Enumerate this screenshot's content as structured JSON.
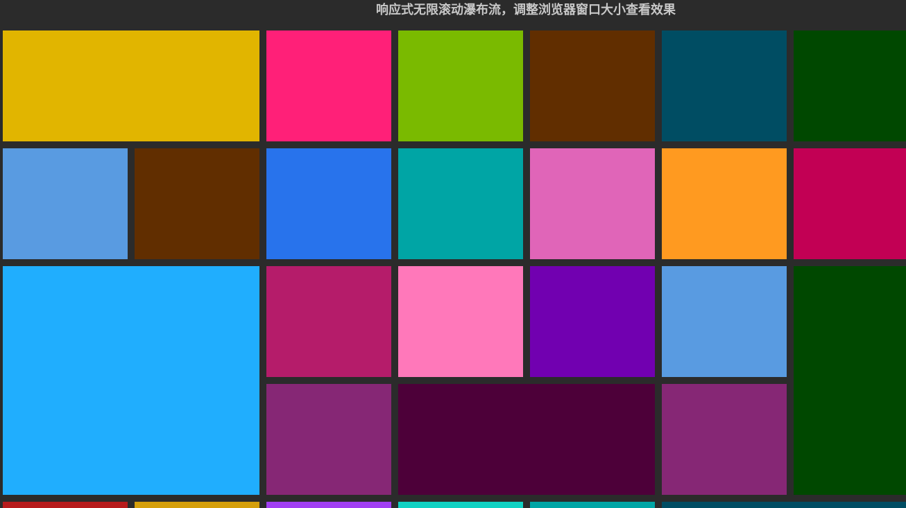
{
  "header": {
    "title": "响应式无限滚动瀑布流，调整浏览器窗口大小查看效果"
  },
  "tiles": [
    {
      "color": "#e1b500"
    },
    {
      "color": "#ff2078"
    },
    {
      "color": "#7aba00"
    },
    {
      "color": "#612e00"
    },
    {
      "color": "#004d63"
    },
    {
      "color": "#004800"
    },
    {
      "color": "#599be1"
    },
    {
      "color": "#612e00"
    },
    {
      "color": "#2873ec"
    },
    {
      "color": "#00a5a5"
    },
    {
      "color": "#e065b8"
    },
    {
      "color": "#ff9a20"
    },
    {
      "color": "#c20054"
    },
    {
      "color": "#20aefe"
    },
    {
      "color": "#b51c6a"
    },
    {
      "color": "#ff78ba"
    },
    {
      "color": "#7100b0"
    },
    {
      "color": "#599be1"
    },
    {
      "color": "#004800"
    },
    {
      "color": "#862775"
    },
    {
      "color": "#4d0039"
    },
    {
      "color": "#862775"
    },
    {
      "color": "#b71b1c"
    },
    {
      "color": "#d59f0b"
    },
    {
      "color": "#a13ff2"
    },
    {
      "color": "#11d2c3"
    },
    {
      "color": "#00a5a5"
    },
    {
      "color": "#004d63"
    }
  ]
}
